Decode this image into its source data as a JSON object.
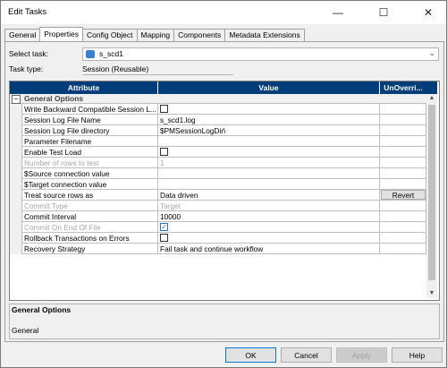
{
  "window": {
    "title": "Edit Tasks",
    "minimize": "—",
    "maximize": "☐",
    "close": "✕"
  },
  "tabs": [
    "General",
    "Properties",
    "Config Object",
    "Mapping",
    "Components",
    "Metadata Extensions"
  ],
  "select_task": {
    "label": "Select task:",
    "value": "s_scd1"
  },
  "task_type": {
    "label": "Task type:",
    "value": "Session (Reusable)"
  },
  "grid": {
    "headers": [
      "Attribute",
      "Value",
      "UnOverri..."
    ],
    "group": "General Options",
    "rows": [
      {
        "attr": "Write Backward Compatible Session L...",
        "value": "",
        "type": "checkbox",
        "checked": false,
        "disabled": false
      },
      {
        "attr": "Session Log File Name",
        "value": "s_scd1.log",
        "type": "text",
        "disabled": false
      },
      {
        "attr": "Session Log File directory",
        "value": "$PMSessionLogDir\\",
        "type": "text",
        "disabled": false
      },
      {
        "attr": "Parameter Filename",
        "value": "",
        "type": "text",
        "disabled": false
      },
      {
        "attr": "Enable Test Load",
        "value": "",
        "type": "checkbox",
        "checked": false,
        "disabled": false
      },
      {
        "attr": "Number of rows to test",
        "value": "1",
        "type": "text",
        "disabled": true
      },
      {
        "attr": "$Source connection value",
        "value": "",
        "type": "text",
        "disabled": false
      },
      {
        "attr": "$Target connection value",
        "value": "",
        "type": "text",
        "disabled": false
      },
      {
        "attr": "Treat source rows as",
        "value": "Data driven",
        "type": "text",
        "disabled": false,
        "revert": "Revert"
      },
      {
        "attr": "Commit Type",
        "value": "Target",
        "type": "text",
        "disabled": true
      },
      {
        "attr": "Commit Interval",
        "value": "10000",
        "type": "text",
        "disabled": false
      },
      {
        "attr": "Commit On End Of File",
        "value": "",
        "type": "checkbox",
        "checked": true,
        "disabled": true
      },
      {
        "attr": "Rollback Transactions on Errors",
        "value": "",
        "type": "checkbox",
        "checked": false,
        "disabled": false
      },
      {
        "attr": "Recovery Strategy",
        "value": "Fail task and continue workflow",
        "type": "text",
        "disabled": false
      }
    ]
  },
  "description": {
    "title": "General Options",
    "text": "General"
  },
  "buttons": {
    "ok": "OK",
    "cancel": "Cancel",
    "apply": "Apply",
    "help": "Help"
  }
}
